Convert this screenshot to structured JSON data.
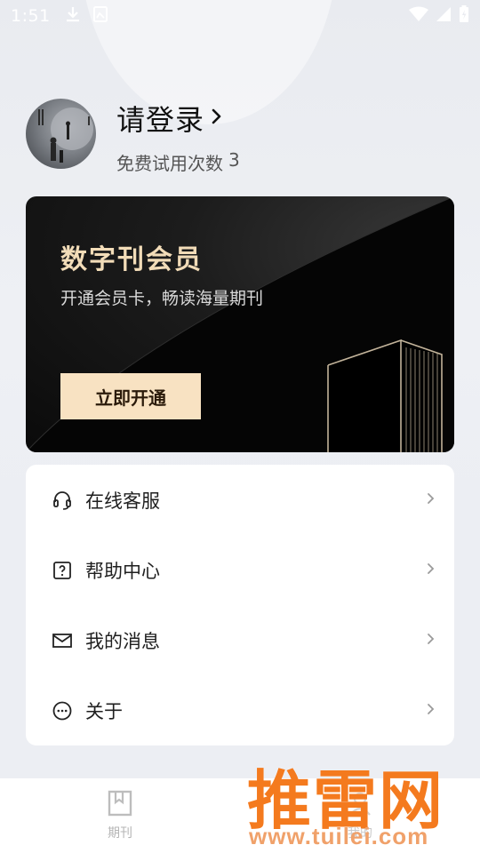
{
  "status_bar": {
    "time": "1:51",
    "left_icons": [
      "download-icon",
      "image-icon"
    ],
    "right_icons": [
      "wifi-icon",
      "signal-icon",
      "battery-icon"
    ]
  },
  "profile": {
    "login_label": "请登录",
    "trial_label": "免费试用次数",
    "trial_count": "3"
  },
  "member_card": {
    "title": "数字刊会员",
    "subtitle": "开通会员卡，畅读海量期刊",
    "button_label": "立即开通",
    "accent_color": "#f2dcb8",
    "button_color": "#f8e2c2"
  },
  "menu": {
    "items": [
      {
        "label": "在线客服",
        "icon": "headset-icon"
      },
      {
        "label": "帮助中心",
        "icon": "help-icon"
      },
      {
        "label": "我的消息",
        "icon": "mail-icon"
      },
      {
        "label": "关于",
        "icon": "more-dots-icon"
      }
    ]
  },
  "bottom_nav": {
    "tabs": [
      {
        "label": "期刊",
        "icon": "bookmark-icon"
      },
      {
        "label": "我的",
        "icon": "user-icon"
      }
    ]
  },
  "watermark": {
    "brand": "推雷网",
    "url": "www.tuilei.com"
  }
}
